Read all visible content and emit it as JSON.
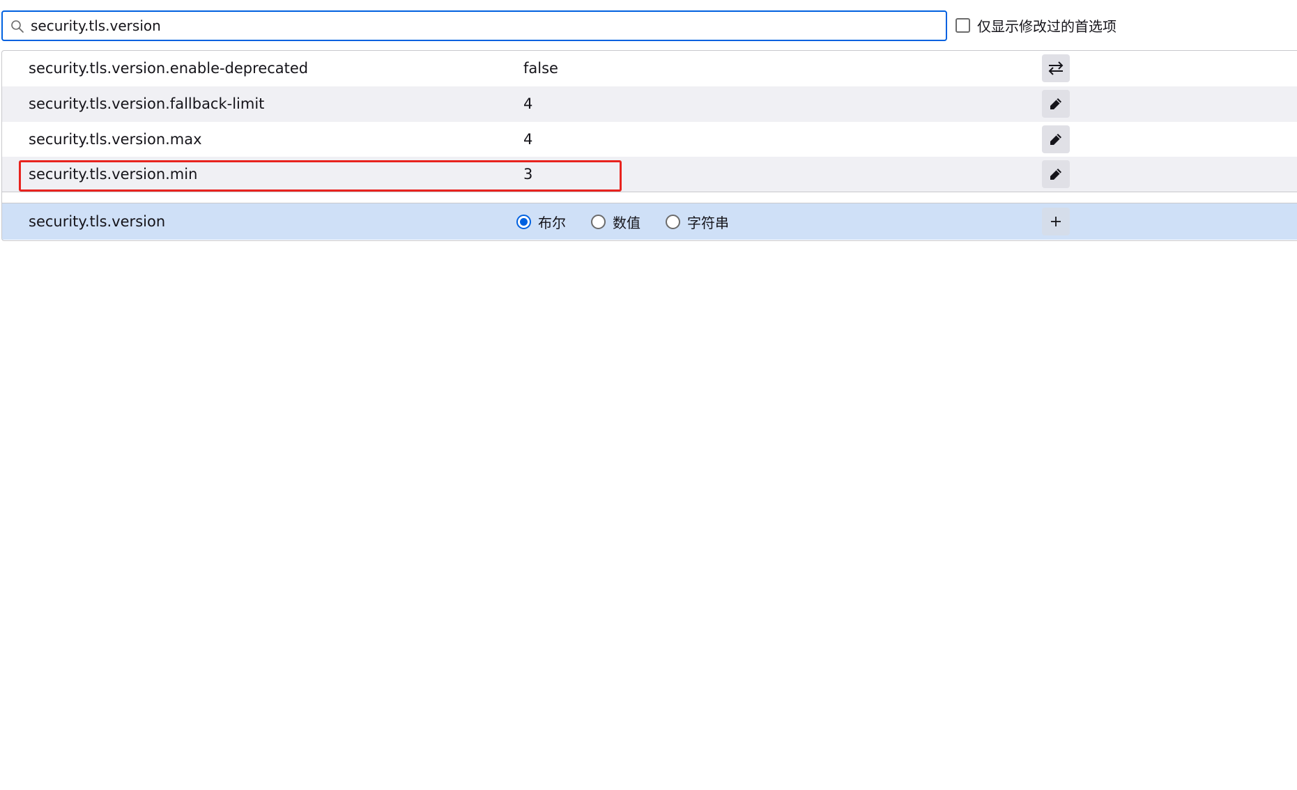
{
  "search": {
    "value": "security.tls.version",
    "icon": "search-icon"
  },
  "filter": {
    "modified_only_label": "仅显示修改过的首选项",
    "checked": false
  },
  "prefs": [
    {
      "name": "security.tls.version.enable-deprecated",
      "value": "false",
      "action": "toggle-icon"
    },
    {
      "name": "security.tls.version.fallback-limit",
      "value": "4",
      "action": "edit-icon"
    },
    {
      "name": "security.tls.version.max",
      "value": "4",
      "action": "edit-icon"
    },
    {
      "name": "security.tls.version.min",
      "value": "3",
      "action": "edit-icon"
    }
  ],
  "new_pref": {
    "name": "security.tls.version",
    "types": [
      {
        "label": "布尔",
        "selected": true
      },
      {
        "label": "数值",
        "selected": false
      },
      {
        "label": "字符串",
        "selected": false
      }
    ],
    "action": "add-icon"
  },
  "colors": {
    "accent": "#0061e0",
    "highlight": "#e8231e",
    "new_row_bg": "#cfe0f7",
    "alt_row_bg": "#f0f0f4"
  }
}
